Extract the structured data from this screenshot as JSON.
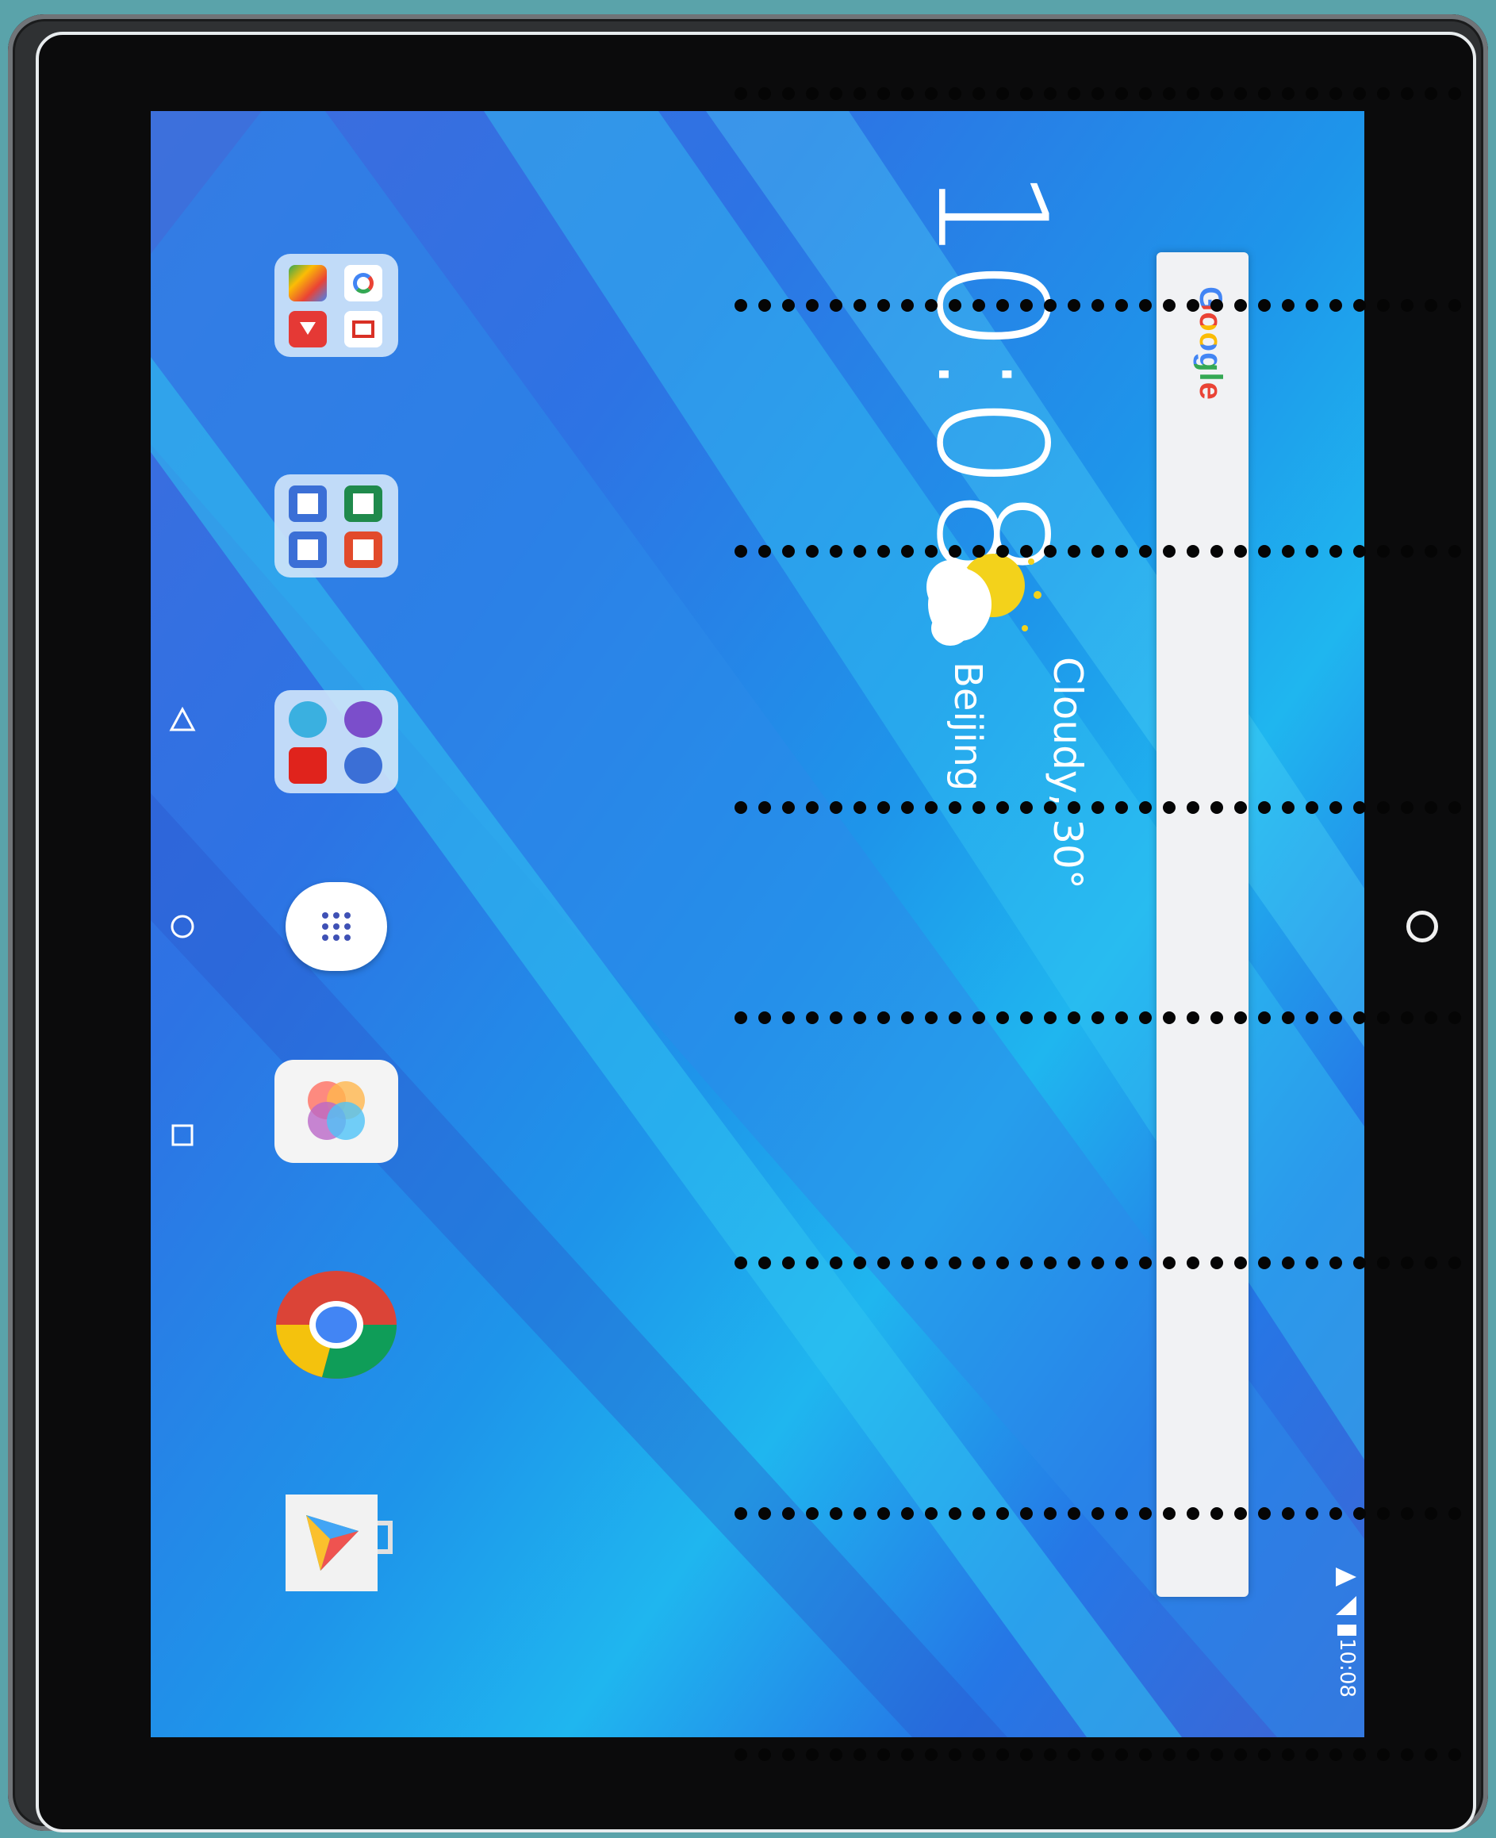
{
  "home_screen": {
    "clock": "10:08",
    "weather_condition": "Cloudy, 30°",
    "weather_city": "Beijing",
    "search_logo": "Google",
    "status_time": "10:08"
  },
  "icons": {
    "google_apps_folder": "google-apps-folder-icon",
    "office_folder": "office-apps-folder-icon",
    "lenovo_folder": "lenovo-apps-folder-icon",
    "app_drawer": "app-drawer-icon",
    "gallery_app": "gallery-app-icon",
    "chrome": "chrome-icon",
    "play_store": "play-store-icon"
  },
  "nav_bar": {
    "back": "back-triangle-icon",
    "home": "home-circle-icon",
    "recents": "recents-square-icon"
  },
  "colors": {
    "screen_blue": "#2d73e4",
    "cyan_accent": "#2ad6ef",
    "bezel": "#0b0b0c",
    "frame": "#2f3133",
    "background": "#5aa3aa"
  }
}
